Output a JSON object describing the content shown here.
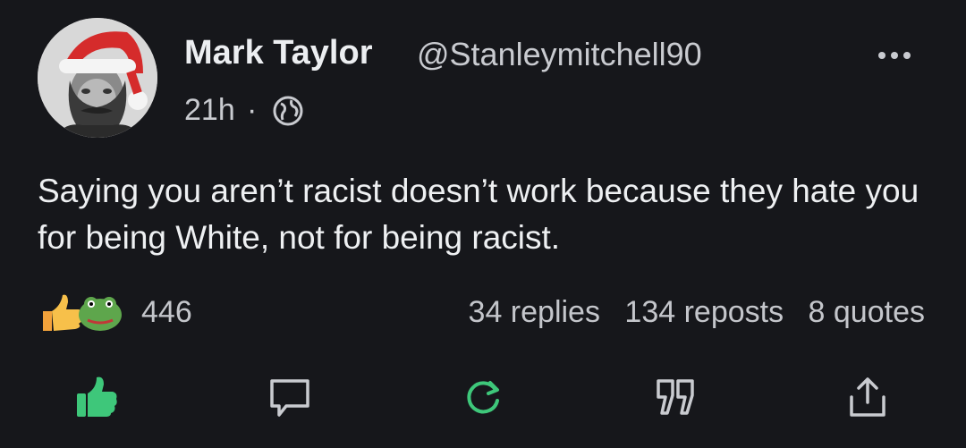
{
  "author": {
    "name": "Mark Taylor",
    "handle": "@Stanleymitchell90",
    "avatar_icon": "avatar-santa-hat"
  },
  "meta": {
    "time": "21h",
    "separator": "·",
    "visibility_icon": "globe-icon"
  },
  "post": {
    "text": "Saying you aren’t racist doesn’t work because they hate you for being White, not for being racist."
  },
  "reactions": {
    "icons": [
      "thumbs-up-icon",
      "frog-icon"
    ],
    "count": "446"
  },
  "stats": {
    "replies": "34 replies",
    "reposts": "134 reposts",
    "quotes": "8 quotes"
  },
  "actions": [
    "like-icon",
    "reply-icon",
    "repost-icon",
    "quote-icon",
    "share-icon"
  ],
  "colors": {
    "background": "#16171b",
    "accent_green": "#3ec77a",
    "text": "#eceef1",
    "muted": "#c4c6cb"
  }
}
